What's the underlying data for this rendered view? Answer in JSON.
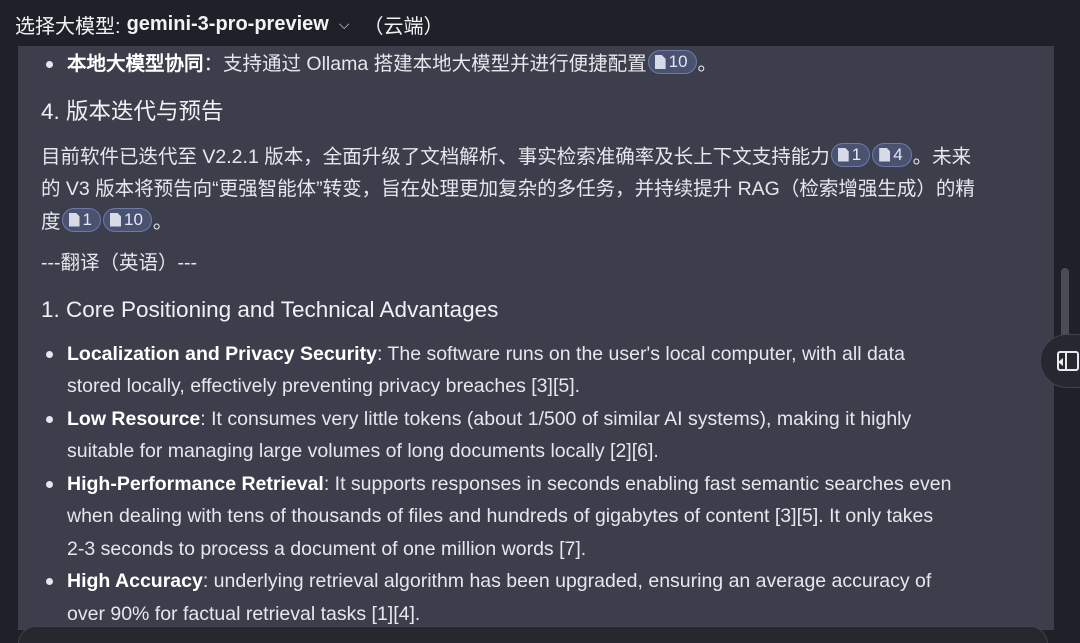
{
  "topbar": {
    "label": "选择大模型:",
    "model": "gemini-3-pro-preview",
    "chevron": "⌵",
    "tag": "（云端）"
  },
  "content": {
    "line1": {
      "bold": "本地大模型协同",
      "text": "：支持通过 Ollama 搭建本地大模型并进行便捷配置",
      "cite": "10",
      "end": "。"
    },
    "section4_title": "4. 版本迭代与预告",
    "para": {
      "t1": "目前软件已迭代至 V2.2.1 版本，全面升级了文档解析、事实检索准确率及长上下文支持能力",
      "c1": "1",
      "c2": "4",
      "t2": "。未来",
      "t3": "的 V3 版本将预告向“更强智能体”转变，旨在处理更加复杂的多任务，并持续提升 RAG（检索增强生成）的精",
      "t4": "度",
      "c3": "1",
      "c4": "10",
      "t5": "。"
    },
    "divider": "---翻译（英语）---",
    "en_title": "1. Core Positioning and Technical Advantages",
    "bullets": [
      {
        "bold": "Localization and Privacy Security",
        "l1": ": The software runs on the user's local computer, with all data",
        "l2": "stored locally, effectively preventing privacy breaches [3][5]."
      },
      {
        "bold": "Low Resource",
        "l1": ": It consumes very little tokens (about 1/500 of similar AI systems), making it highly",
        "l2": "suitable for managing large volumes of long documents locally [2][6]."
      },
      {
        "bold": "High-Performance Retrieval",
        "l1": ": It supports responses in seconds enabling fast semantic searches even",
        "l2": "when dealing with tens of thousands of files and hundreds of gigabytes of content [3][5]. It only takes",
        "l3": "2-3 seconds to process a document of one million words [7]."
      },
      {
        "bold": "High Accuracy",
        "l1": ": underlying retrieval algorithm has been upgraded, ensuring an average accuracy of",
        "l2": "over 90% for factual retrieval tasks [1][4]."
      }
    ]
  },
  "icons": {
    "citation": "document-icon",
    "sidebar_toggle": "sidebar-toggle-icon"
  }
}
